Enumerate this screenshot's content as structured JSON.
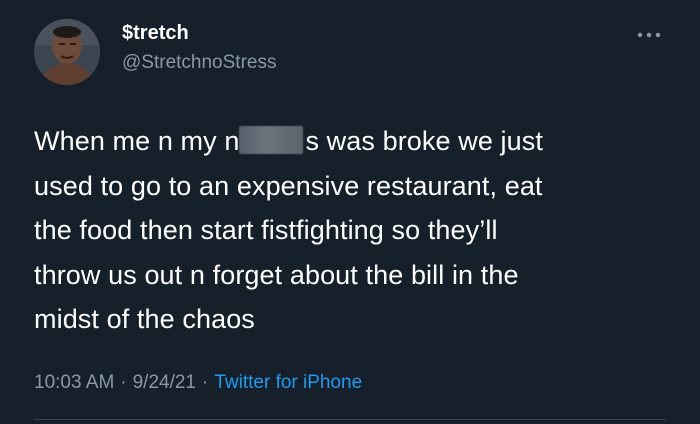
{
  "author": {
    "display_name": "$tretch",
    "handle": "@StretchnoStress",
    "avatar_icon": "user-avatar-photo"
  },
  "more_icon": "more-horizontal-icon",
  "tweet": {
    "lines": [
      {
        "before": "When me n my n",
        "censored": true,
        "after": "s was broke we just"
      },
      {
        "text": "used to go to an expensive restaurant, eat"
      },
      {
        "text": "the food then start fistfighting so they’ll"
      },
      {
        "text": "throw us out n forget about the bill in the"
      },
      {
        "text": "midst of the chaos"
      }
    ]
  },
  "meta": {
    "time": "10:03 AM",
    "separator": "·",
    "date": "9/24/21",
    "source": "Twitter for iPhone"
  },
  "colors": {
    "background": "#15202b",
    "text": "#ffffff",
    "secondary": "#8b98a5",
    "link": "#1d9bf0"
  }
}
